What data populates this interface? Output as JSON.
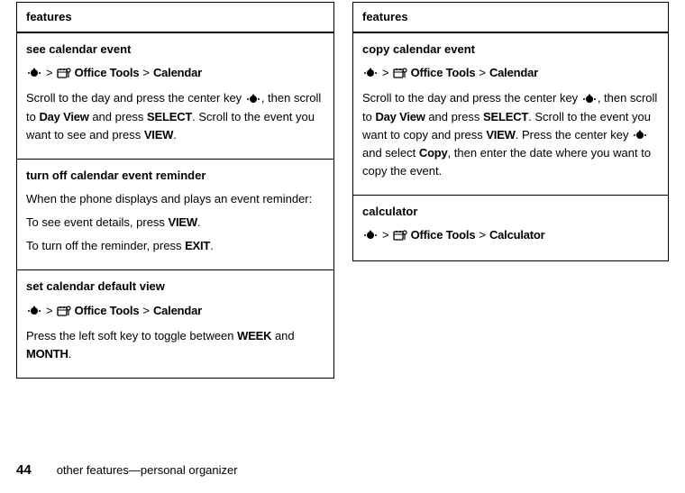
{
  "left": {
    "header": "features",
    "cells": [
      {
        "title": "see calendar event",
        "nav_mid": "Office Tools",
        "nav_end": "Calendar",
        "p1_a": "Scroll to the day and press the center key ",
        "p1_b": ", then scroll to ",
        "dayview": "Day View",
        "p1_c": " and press ",
        "select": "SELECT",
        "p1_d": ". Scroll to the event you want to see and press ",
        "view": "VIEW",
        "p1_e": "."
      },
      {
        "title": "turn off calendar event reminder",
        "p1": "When the phone displays and plays an event reminder:",
        "p2_a": "To see event details, press ",
        "view": "VIEW",
        "p2_b": ".",
        "p3_a": "To turn off the reminder, press ",
        "exit": "EXIT",
        "p3_b": "."
      },
      {
        "title": "set calendar default view",
        "nav_mid": "Office Tools",
        "nav_end": "Calendar",
        "p1_a": "Press the left soft key to toggle between ",
        "week": "WEEK",
        "p1_b": " and ",
        "month": "MONTH",
        "p1_c": "."
      }
    ]
  },
  "right": {
    "header": "features",
    "cells": [
      {
        "title": "copy calendar event",
        "nav_mid": "Office Tools",
        "nav_end": "Calendar",
        "p1_a": "Scroll to the day and press the center key ",
        "p1_b": ", then scroll to ",
        "dayview": "Day View",
        "p1_c": " and press ",
        "select": "SELECT",
        "p1_d": ". Scroll to the event you want to copy and press ",
        "view": "VIEW",
        "p1_e": ". Press the center key ",
        "p1_f": " and select ",
        "copy": "Copy",
        "p1_g": ", then enter the date where you want to copy the event."
      },
      {
        "title": "calculator",
        "nav_mid": "Office Tools",
        "nav_end": "Calculator"
      }
    ]
  },
  "footer": {
    "page": "44",
    "text": "other features—personal organizer"
  }
}
